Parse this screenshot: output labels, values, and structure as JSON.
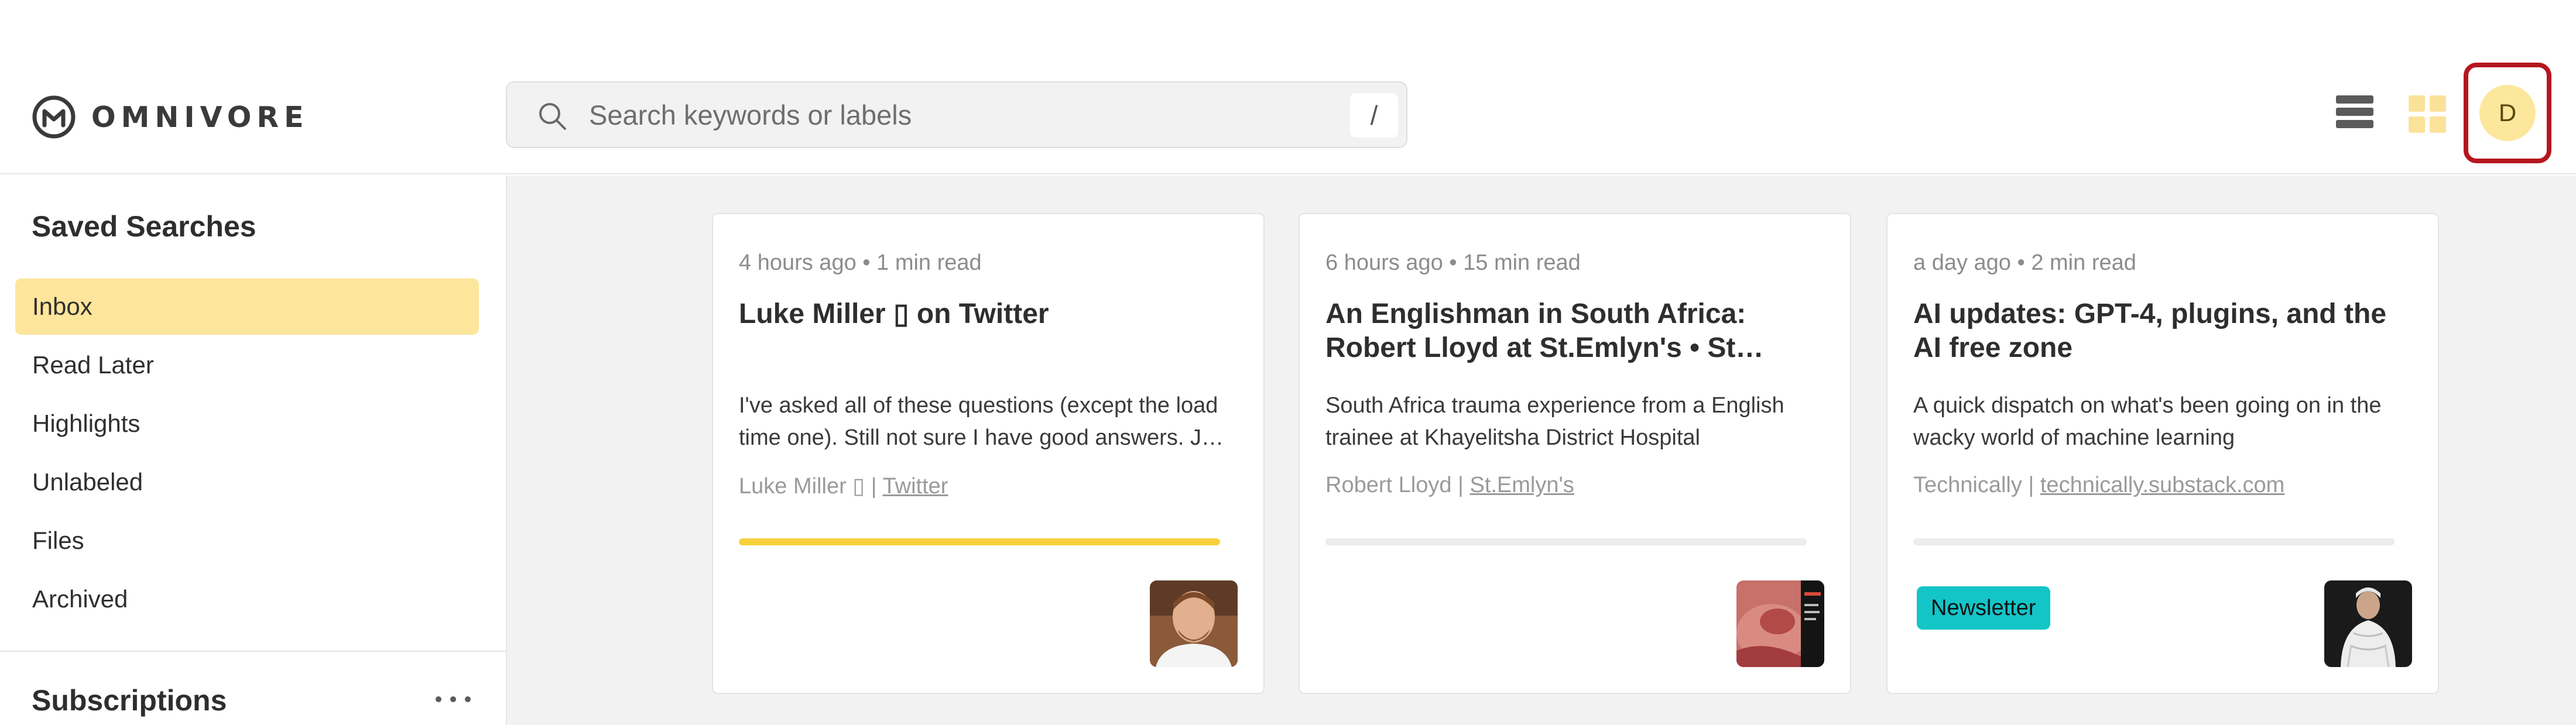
{
  "header": {
    "logo_text": "OMNIVORE",
    "search": {
      "placeholder": "Search keywords or labels",
      "shortcut": "/"
    },
    "avatar_initial": "D"
  },
  "sidebar": {
    "saved_title": "Saved Searches",
    "items": [
      {
        "label": "Inbox",
        "active": true
      },
      {
        "label": "Read Later",
        "active": false
      },
      {
        "label": "Highlights",
        "active": false
      },
      {
        "label": "Unlabeled",
        "active": false
      },
      {
        "label": "Files",
        "active": false
      },
      {
        "label": "Archived",
        "active": false
      }
    ],
    "subscriptions_title": "Subscriptions"
  },
  "cards": [
    {
      "meta": "4 hours ago • 1 min read",
      "title": "Luke Miller ▯ on Twitter",
      "desc_line1": "I've asked all of these questions (except the load",
      "desc_line2": "time one). Still not sure I have good answers. J…",
      "author": "Luke Miller ▯",
      "separator": " | ",
      "source": "Twitter",
      "progress": 1.0,
      "progress_color": "#f7d23e",
      "badge": ""
    },
    {
      "meta": "6 hours ago • 15 min read",
      "title": "An Englishman in South Africa: Robert Lloyd at St.Emlyn's • St…",
      "desc_line1": "South Africa trauma experience from a English",
      "desc_line2": "trainee at Khayelitsha District Hospital",
      "author": "Robert Lloyd",
      "separator": " | ",
      "source": "St.Emlyn's",
      "progress": 0.0,
      "badge": ""
    },
    {
      "meta": "a day ago • 2 min read",
      "title": "AI updates: GPT-4, plugins, and the AI free zone",
      "desc_line1": "A quick dispatch on what's been going on in the",
      "desc_line2": "wacky world of machine learning",
      "author": "Technically",
      "separator": " | ",
      "source": "technically.substack.com",
      "progress": 0.0,
      "badge": "Newsletter"
    }
  ],
  "colors": {
    "accent": "#fde69b",
    "avatar_frame": "#b5161e",
    "badge": "#14c5c7",
    "main_bg": "#f2f2f2"
  }
}
